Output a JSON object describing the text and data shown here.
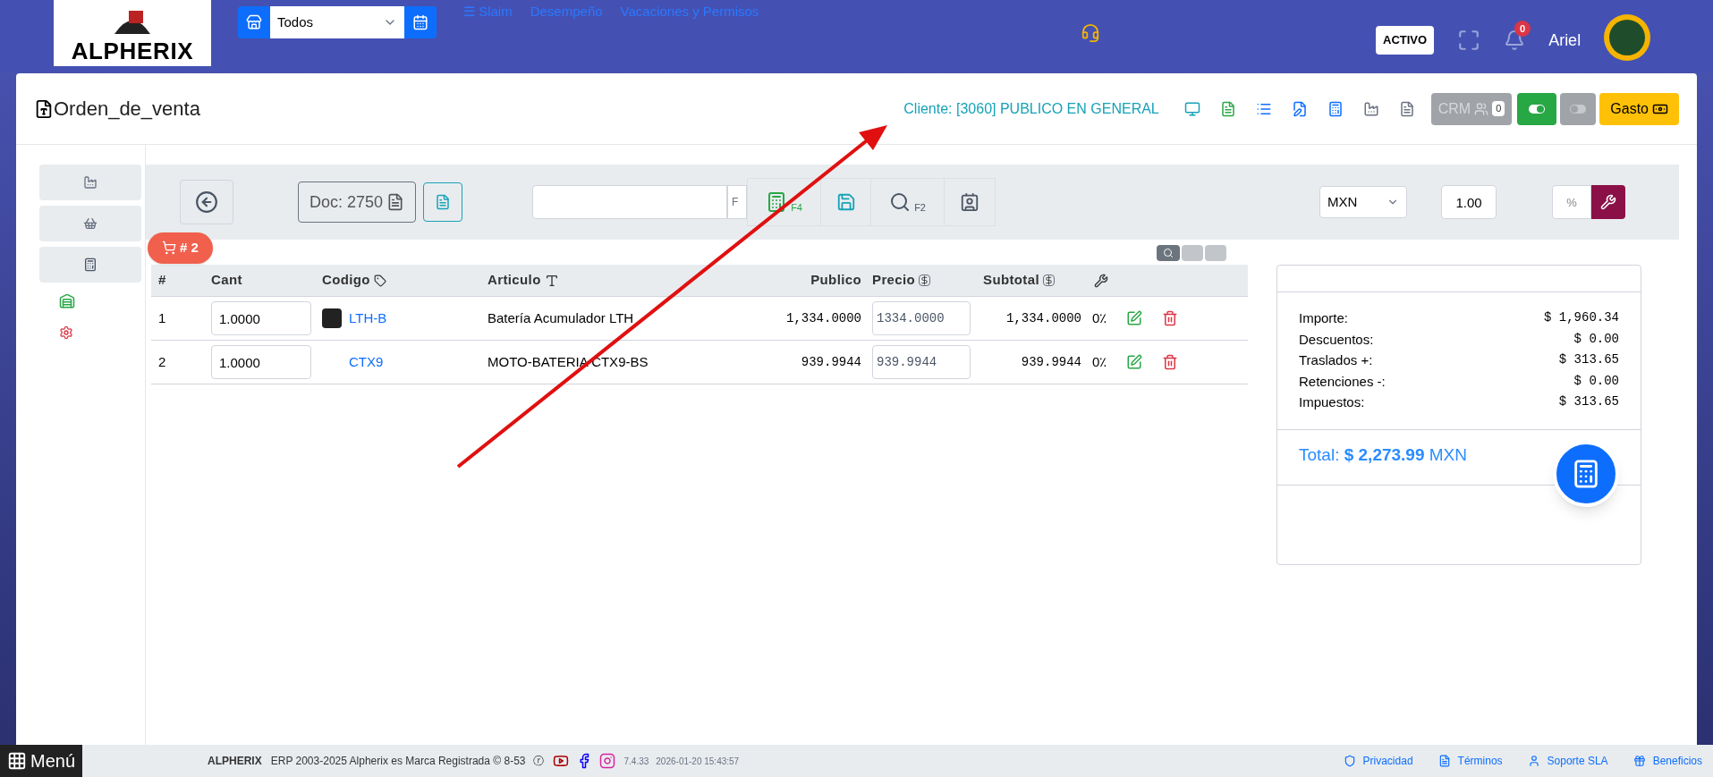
{
  "topbar": {
    "logo": "ALPHERIX",
    "branch_select": "Todos",
    "links": [
      "☰ Slaim",
      "Desempeño",
      "Vacaciones y Permisos"
    ],
    "status": "ACTIVO",
    "notifications": "0",
    "user": "Ariel"
  },
  "header": {
    "title": "Orden_de_venta",
    "client": "Cliente: [3060] PUBLICO EN GENERAL",
    "crm": "CRM",
    "crm_count": "0",
    "toggle_on": true,
    "toggle2_on": false,
    "expense": "Gasto"
  },
  "toolbar": {
    "doc": "Doc: 2750",
    "key_hint": "F",
    "sale_key": "F4",
    "search_key": "F2",
    "currency": "MXN",
    "rate": "1.00",
    "percent_placeholder": "%"
  },
  "cart_badge": "# 2",
  "table": {
    "columns": [
      "#",
      "Cant",
      "Codigo",
      "Articulo",
      "Publico",
      "Precio",
      "Subtotal"
    ],
    "rows": [
      {
        "n": "1",
        "qty": "1.0000",
        "code": "LTH-B",
        "has_image": true,
        "article": "Batería Acumulador LTH",
        "public": "1,334.0000",
        "price": "1334.0000",
        "subtotal": "1,334.0000",
        "discount": "0٪"
      },
      {
        "n": "2",
        "qty": "1.0000",
        "code": "CTX9",
        "has_image": false,
        "article": "MOTO-BATERIA CTX9-BS",
        "public": "939.9944",
        "price": "939.9944",
        "subtotal": "939.9944",
        "discount": "0٪"
      }
    ]
  },
  "totals": {
    "lines": [
      {
        "label": "Importe:",
        "value": "$ 1,960.34"
      },
      {
        "label": "Descuentos:",
        "value": "$ 0.00"
      },
      {
        "label": "Traslados +:",
        "value": "$ 313.65"
      },
      {
        "label": "Retenciones -:",
        "value": "$ 0.00"
      },
      {
        "label": "Impuestos:",
        "value": "$ 313.65"
      }
    ],
    "total_label": "Total:",
    "total_value": "$ 2,273.99",
    "total_currency": "MXN"
  },
  "footer": {
    "menu": "Menú",
    "brand": "ALPHERIX",
    "copyright": "ERP 2003-2025 Alpherix es Marca Registrada © 8-53",
    "mark": "ⓡ",
    "version": "7.4.33",
    "datetime": "2026-01-20 15:43:57",
    "links": [
      "Privacidad",
      "Términos",
      "Soporte SLA",
      "Beneficios"
    ]
  }
}
